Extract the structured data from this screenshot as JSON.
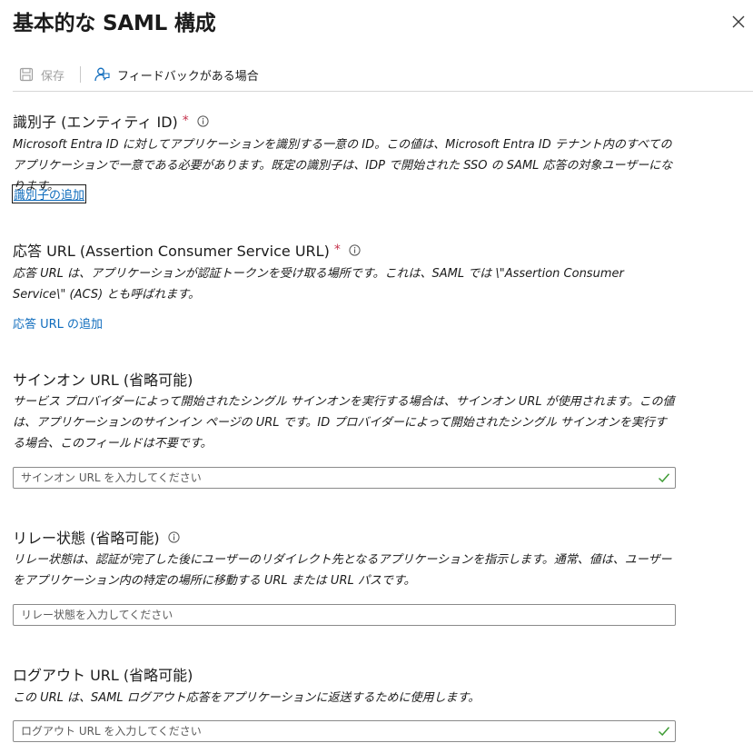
{
  "panel": {
    "title": "基本的な SAML 構成"
  },
  "toolbar": {
    "save_label": "保存",
    "feedback_label": "フィードバックがある場合"
  },
  "identifier": {
    "label": "識別子 (エンティティ ID)",
    "required": "*",
    "description": "Microsoft Entra ID に対してアプリケーションを識別する一意の ID。この値は、Microsoft Entra ID テナント内のすべてのアプリケーションで一意である必要があります。既定の識別子は、IDP で開始された SSO の SAML 応答の対象ユーザーになります。",
    "add_link": "識別子の追加"
  },
  "reply_url": {
    "label": "応答 URL (Assertion Consumer Service URL)",
    "required": "*",
    "description": "応答 URL は、アプリケーションが認証トークンを受け取る場所です。これは、SAML では \\\"Assertion Consumer Service\\\" (ACS) とも呼ばれます。",
    "add_link": "応答 URL の追加"
  },
  "sign_on_url": {
    "label": "サインオン URL (省略可能)",
    "description": "サービス プロバイダーによって開始されたシングル サインオンを実行する場合は、サインオン URL が使用されます。この値は、アプリケーションのサインイン ページの URL です。ID プロバイダーによって開始されたシングル サインオンを実行する場合、このフィールドは不要です。",
    "placeholder": "サインオン URL を入力してください"
  },
  "relay_state": {
    "label": "リレー状態 (省略可能)",
    "description": "リレー状態は、認証が完了した後にユーザーのリダイレクト先となるアプリケーションを指示します。通常、値は、ユーザーをアプリケーション内の特定の場所に移動する URL または URL パスです。",
    "placeholder": "リレー状態を入力してください"
  },
  "logout_url": {
    "label": "ログアウト URL (省略可能)",
    "description": "この URL は、SAML ログアウト応答をアプリケーションに返送するために使用します。",
    "placeholder": "ログアウト URL を入力してください"
  },
  "icons": {
    "close": "close-icon",
    "save": "save-icon",
    "feedback": "feedback-person-icon",
    "info": "info-icon",
    "check": "check-icon"
  },
  "colors": {
    "accent_link": "#0f6cbd",
    "required_star": "#c4314b",
    "valid_check": "#3f9c35",
    "disabled_text": "#a0a0a0"
  }
}
